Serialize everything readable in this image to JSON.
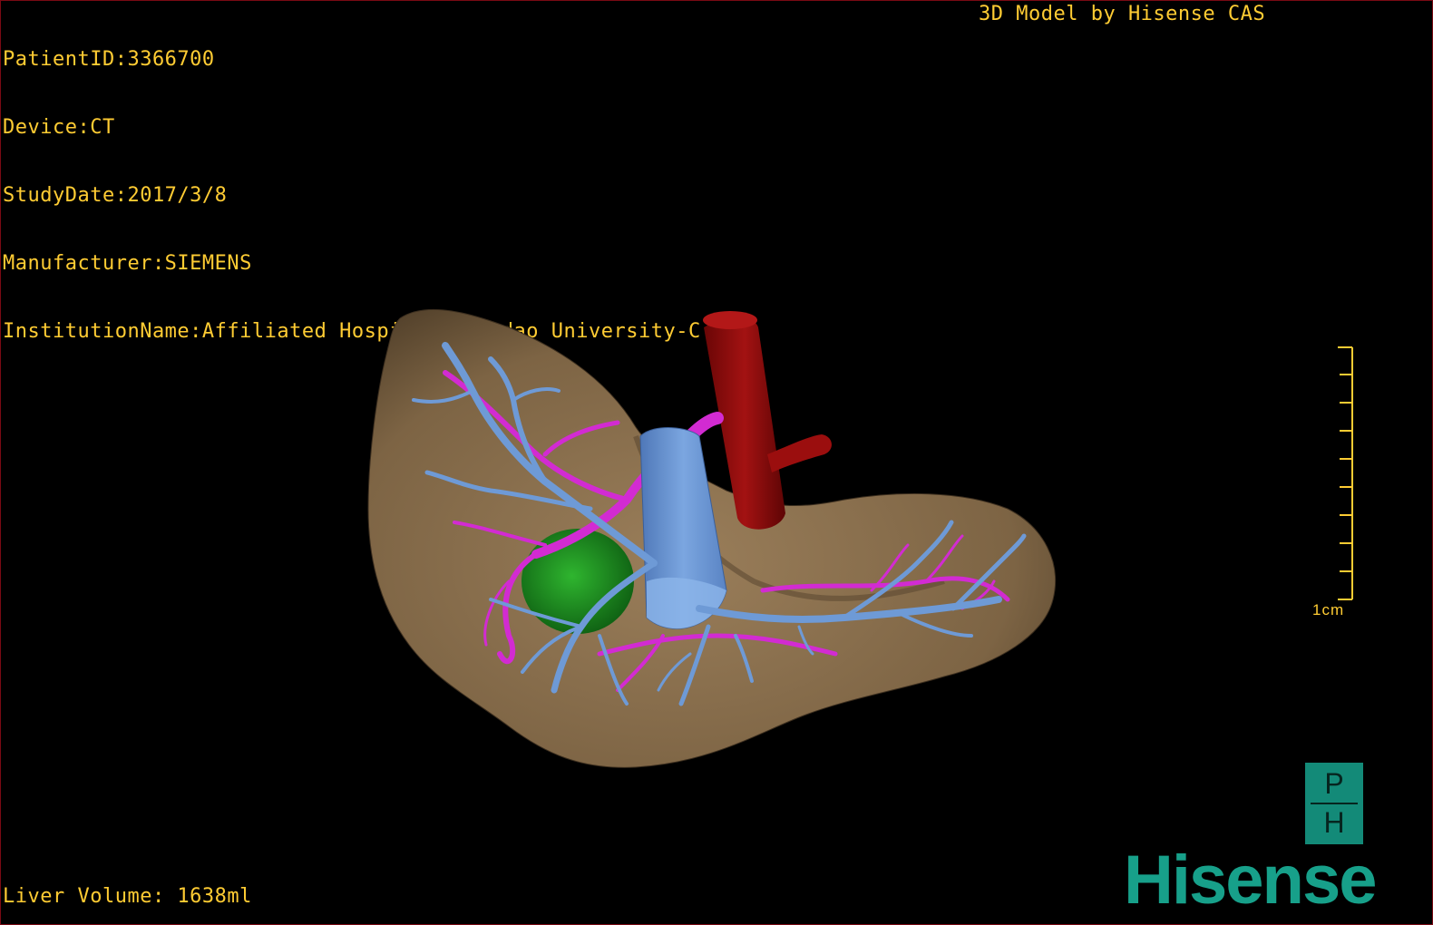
{
  "header": {
    "patient_id": "PatientID:3366700",
    "device": "Device:CT",
    "study_date": "StudyDate:2017/3/8",
    "manufacturer": "Manufacturer:SIEMENS",
    "institution": "InstitutionName:Affiliated Hospital Qingdao University-C"
  },
  "credit": "3D Model by Hisense CAS",
  "footer": {
    "liver_volume": "Liver Volume: 1638ml"
  },
  "scale_bar": {
    "label": "1cm"
  },
  "logo": {
    "badge_top": "P",
    "badge_bottom": "H",
    "brand": "Hisense"
  },
  "colors": {
    "overlay_text": "#ffcc33",
    "liver": "#8a7050",
    "portal_vein": "#6e9ad6",
    "hepatic_vein": "#d22bd2",
    "artery": "#8b0a0a",
    "tumor": "#1f8a1f",
    "brand": "#17a08a"
  }
}
